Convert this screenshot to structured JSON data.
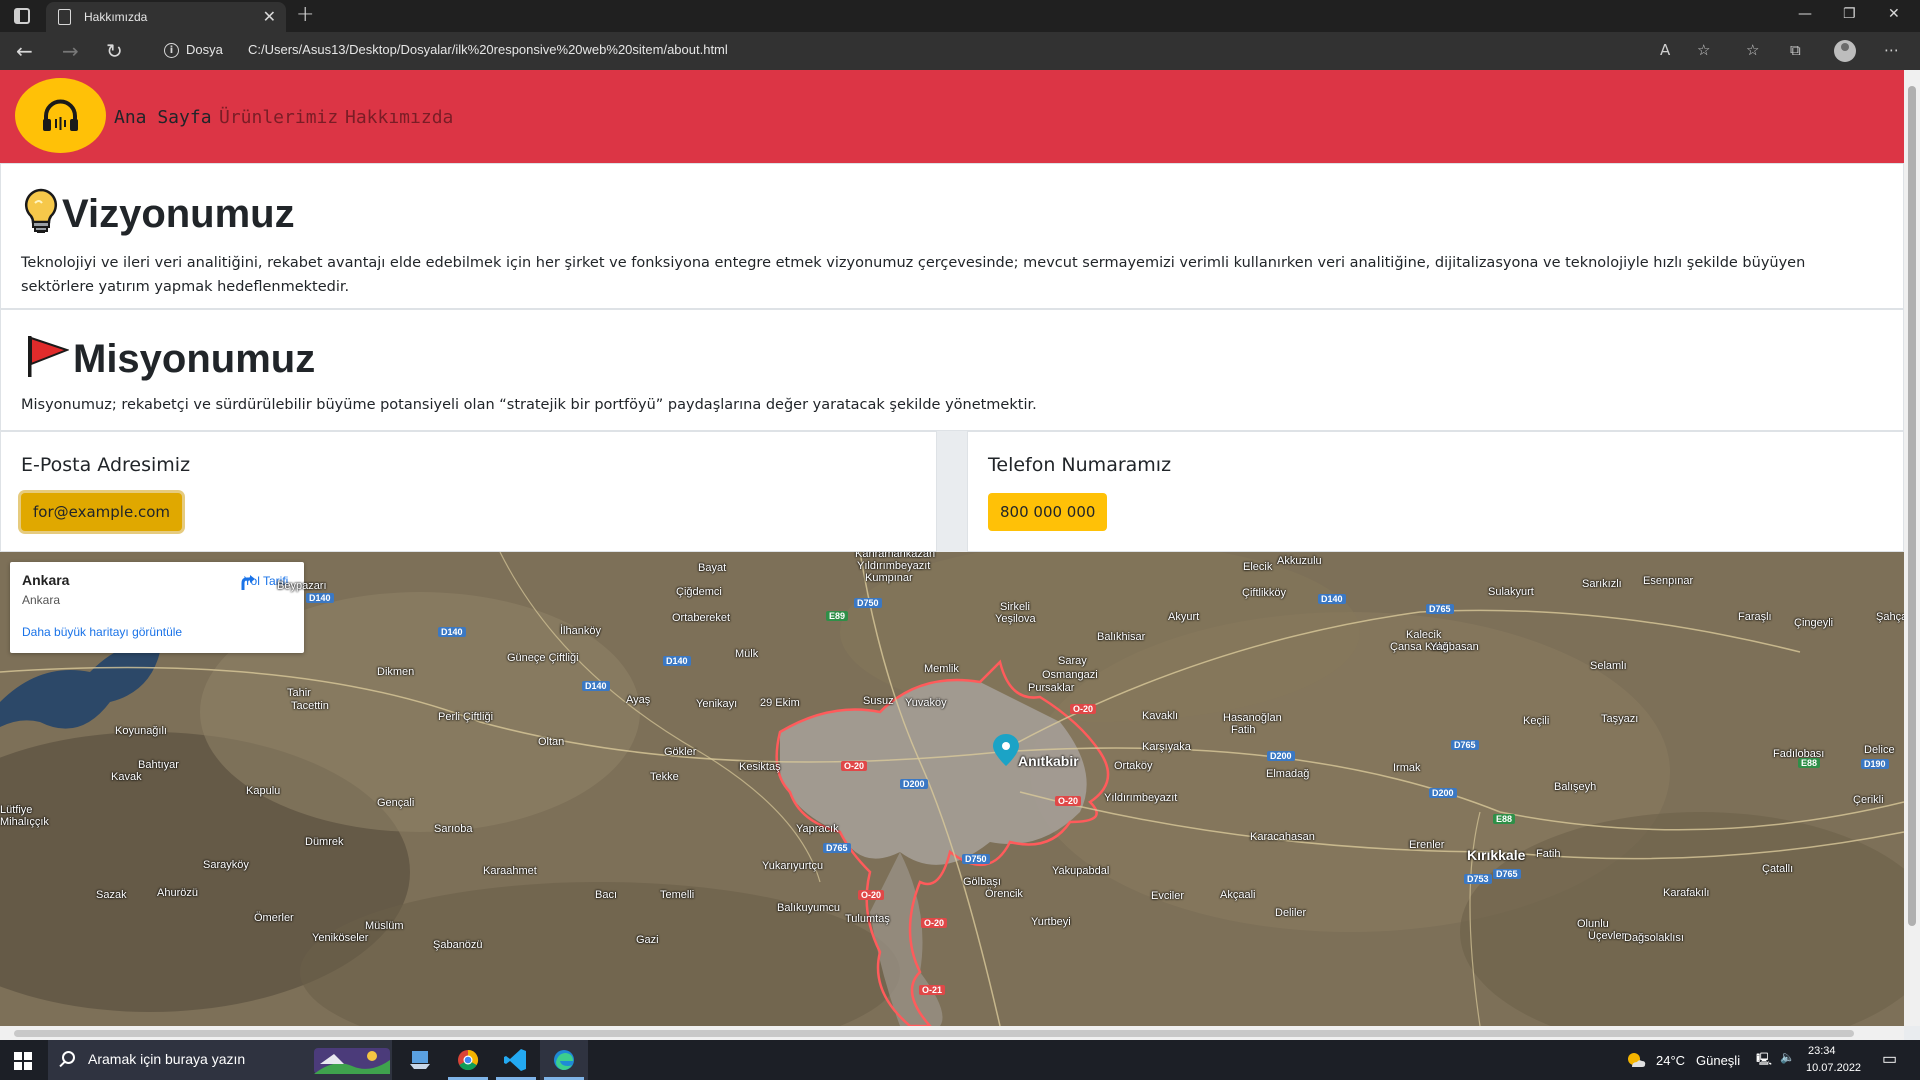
{
  "browser": {
    "tab_title": "Hakkımızda",
    "site_label": "Dosya",
    "url": "C:/Users/Asus13/Desktop/Dosyalar/ilk%20responsive%20web%20sitem/about.html"
  },
  "nav": {
    "links": [
      "Ana Sayfa",
      "Ürünlerimiz",
      "Hakkımızda"
    ]
  },
  "vision": {
    "title": "Vizyonumuz",
    "text": "Teknolojiyi ve ileri veri analitiğini, rekabet avantajı elde edebilmek için her şirket ve fonksiyona entegre etmek vizyonumuz çerçevesinde; mevcut sermayemizi verimli kullanırken veri analitiğine, dijitalizasyona ve teknolojiyle hızlı şekilde büyüyen sektörlere yatırım yapmak hedeflenmektedir."
  },
  "mission": {
    "title": "Misyonumuz",
    "text": "Misyonumuz; rekabetçi ve sürdürülebilir büyüme potansiyeli olan “stratejik bir portföyü” paydaşlarına değer yaratacak şekilde yönetmektir."
  },
  "email": {
    "title": "E-Posta Adresimiz",
    "button": "for@example.com"
  },
  "phone": {
    "title": "Telefon Numaramız",
    "button": "800 000 000"
  },
  "map": {
    "info_title": "Ankara",
    "info_sub": "Ankara",
    "directions": "Yol Tarifi",
    "larger_map": "Daha büyük haritayı görüntüle",
    "places": [
      "Bayat",
      "Kahramankazan",
      "Yıldırımbeyazıt",
      "Kumpınar",
      "Çiğdemci",
      "Ortabereket",
      "Beypazarı",
      "İlhanköy",
      "Güneçe Çiftliği",
      "Dikmen",
      "Mülk",
      "Sirkeli",
      "Yeşilova",
      "Balıkhisar",
      "Akyurt",
      "Elecik",
      "Çiftlikköy",
      "Akkuzulu",
      "Sulakyurt",
      "Sarıkızlı",
      "Esenpınar",
      "Faraşlı",
      "Çingeyli",
      "Şahçalı",
      "Kalecik",
      "Çansa Kale",
      "Yağbasan",
      "Selamlı",
      "Saray",
      "Memlik",
      "Osmangazi",
      "Pursaklar",
      "Tahir",
      "Tacettin",
      "Perli Çiftliği",
      "Ayaş",
      "Yenikayı",
      "29 Ekim",
      "Susuz",
      "Yuvaköy",
      "Kavaklı",
      "Hasanoğlan",
      "Fatih",
      "Keçili",
      "Taşyazı",
      "Koyunağılı",
      "Oltan",
      "Gökler",
      "Kesiktaş",
      "Anıtkabir",
      "Karşıyaka",
      "Elmadağ",
      "Irmak",
      "Fadılobası",
      "Delice",
      "Bahtıyar",
      "Kavak",
      "Tekke",
      "Ortaköy",
      "Yıldırımbeyazıt",
      "Balışeyh",
      "Çerikli",
      "Kapulu",
      "Lütfiye",
      "Mihalıççık",
      "Gençali",
      "Sarıoba",
      "Yapracık",
      "Karacahasan",
      "Erenler",
      "Fatih",
      "Kırıkkale",
      "Dümrek",
      "Sarayköy",
      "Karaahmet",
      "Yukarıyurtçu",
      "Yakupabdal",
      "Çatallı",
      "Sazak",
      "Ahurözü",
      "Bacı",
      "Temelli",
      "Gölbaşı",
      "Örencik",
      "Evciler",
      "Akçaali",
      "Karafakılı",
      "Balıkuyumcu",
      "Ömerler",
      "Yurtbeyi",
      "Deliler",
      "Olunlu",
      "Üçevler",
      "Müslüm",
      "Yeniköseler",
      "Tulumtaş",
      "Şabanözü",
      "Gazi",
      "Dağsolaklısı"
    ],
    "roads": [
      "D140",
      "D750",
      "E89",
      "D140",
      "D140",
      "D140",
      "D140",
      "D765",
      "D765",
      "D200",
      "D200",
      "D200",
      "E88",
      "D190",
      "D765",
      "E88",
      "D750",
      "D753",
      "D765",
      "O-20",
      "O-20",
      "O-20",
      "O-20",
      "O-20",
      "O-21"
    ]
  },
  "taskbar": {
    "search_placeholder": "Aramak için buraya yazın",
    "weather_temp": "24°C",
    "weather_text": "Güneşli",
    "time": "23:34",
    "date": "10.07.2022"
  },
  "colors": {
    "navbar": "#dc3545",
    "accent_yellow": "#ffc107",
    "link_active": "#212529",
    "link_muted": "#7a1d26"
  }
}
